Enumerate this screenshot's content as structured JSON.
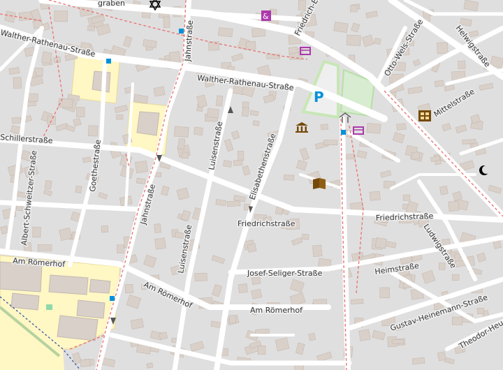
{
  "streets": {
    "grabben": "graben",
    "rathenau_west": "Walther-Rathenau-Straße",
    "rathenau_east": "Walther-Rathenau-Straße",
    "schiller": "Schillerstraße",
    "albert": "Albert-Schweitzer-Straße",
    "goethe": "Goethestraße",
    "jahn_north": "Jahnstraße",
    "jahn_south": "Jahnstraße",
    "luisen_north": "Luisenstraße",
    "luisen_south": "Luisenstraße",
    "elisabethen": "Elisabethenstraße",
    "friedrich_ebert": "Friedrich-E…",
    "friedrich_west": "Friedrichstraße",
    "friedrich_east": "Friedrichstraße",
    "otto_wels": "Otto-Wels-Straße",
    "helwig": "Helwigstraße",
    "mittel": "Mittelstraße",
    "ludwig": "Ludwigstraße",
    "seliger": "Josef-Seliger-Straße",
    "heim": "Heimstraße",
    "heinemann": "Gustav-Heinemann-Straße",
    "roemerhof_west": "Am Römerhof",
    "roemerhof_mid": "Am Römerhof",
    "roemerhof_east": "Am Römerhof",
    "theodor": "Theodor-Heu…"
  },
  "pois": {
    "parking_label": "P"
  },
  "colors": {
    "background": "#e0dfdf",
    "road": "#ffffff",
    "building": "#d9d0c9",
    "school": "#fff7c4",
    "parking": "#efefef",
    "park": "#c8facc",
    "rail_dash": "#e87070",
    "water_dash": "#3355aa"
  }
}
